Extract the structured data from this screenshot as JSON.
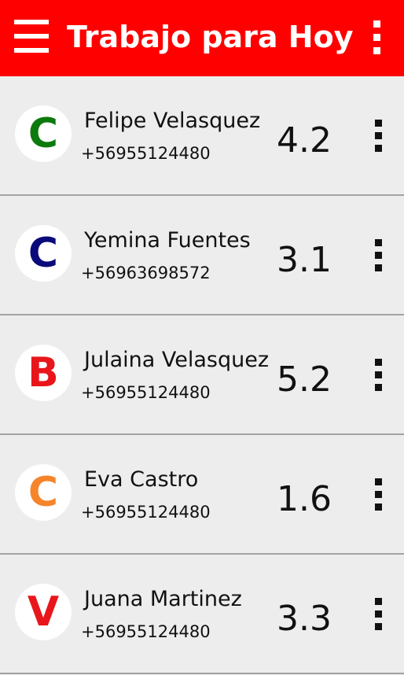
{
  "header": {
    "title": "Trabajo para Hoy",
    "background_color": "#fe0000",
    "menu_icon": "hamburger-icon",
    "overflow_icon": "more-vert-icon"
  },
  "workers": [
    {
      "initial": "C",
      "initial_color": "#0c7a0c",
      "name": "Felipe Velasquez",
      "phone": "+56955124480",
      "score": "4.2"
    },
    {
      "initial": "C",
      "initial_color": "#0a0a7a",
      "name": "Yemina Fuentes",
      "phone": "+56963698572",
      "score": "3.1"
    },
    {
      "initial": "B",
      "initial_color": "#e8161b",
      "name": "Julaina Velasquez",
      "phone": "+56955124480",
      "score": "5.2"
    },
    {
      "initial": "C",
      "initial_color": "#f5842a",
      "name": "Eva Castro",
      "phone": "+56955124480",
      "score": "1.6"
    },
    {
      "initial": "V",
      "initial_color": "#e8161b",
      "name": "Juana Martinez",
      "phone": "+56955124480",
      "score": "3.3"
    }
  ]
}
